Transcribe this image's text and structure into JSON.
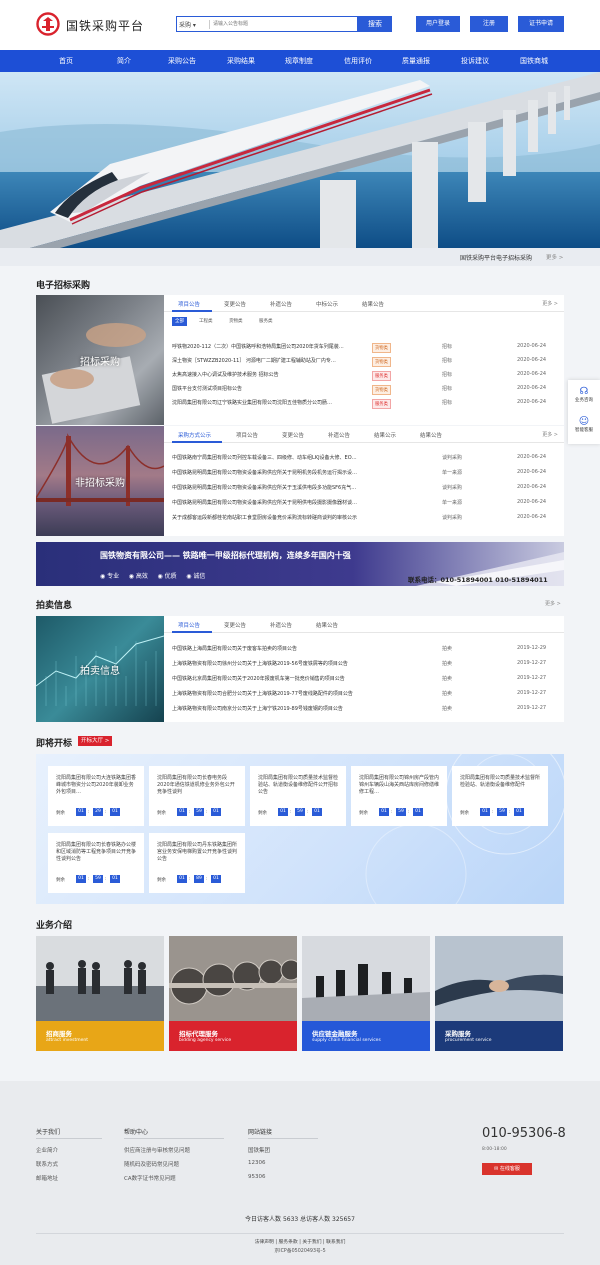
{
  "header": {
    "site_title": "国铁采购平台",
    "search_category": "采购",
    "search_placeholder": "请输入公告标题",
    "search_button": "搜索",
    "buttons": [
      "用户登录",
      "注册",
      "证书申请"
    ]
  },
  "nav": [
    "首页",
    "简介",
    "采购公告",
    "采购结果",
    "规章制度",
    "信用评价",
    "质量通报",
    "投诉建议",
    "国铁商城"
  ],
  "notice": {
    "text": "国铁采购平台电子招标采购",
    "more": "更多 >"
  },
  "tender": {
    "section_title": "电子招标采购",
    "photo_label": "招标采购",
    "tabs": [
      "项目公告",
      "变更公告",
      "补遗公告",
      "中标公示",
      "结果公告"
    ],
    "more": "更多 >",
    "chips": [
      "全部",
      "工程类",
      "货物类",
      "服务类"
    ],
    "rows": [
      {
        "title": "呼铁物2020-112（二次）中国铁路呼和浩特局集团公司2020年货车列尾装…",
        "tag": "货物类",
        "kind": "招标",
        "date": "2020-06-24"
      },
      {
        "title": "深土物资［STWZZB2020-11］ 河源电厂二期扩建工程辅助站及厂内专…",
        "tag": "货物类",
        "kind": "招标",
        "date": "2020-06-24"
      },
      {
        "title": "太焦高速接入中心调试及维护技术服务 招标公告",
        "tag": "服务类",
        "kind": "招标",
        "date": "2020-06-24"
      },
      {
        "title": "国铁平台支付测试项目招标公告",
        "tag": "货物类",
        "kind": "招标",
        "date": "2020-06-24"
      },
      {
        "title": "沈阳局集团有限公司辽宁铁路实业集团有限公司沈阳五佳物质分公司肠…",
        "tag": "服务类",
        "kind": "招标",
        "date": "2020-06-24"
      }
    ]
  },
  "nontender": {
    "photo_label": "非招标采购",
    "tabs": [
      "采购方式公示",
      "项目公告",
      "变更公告",
      "补遗公告",
      "结果公示",
      "结果公告"
    ],
    "more": "更多 >",
    "rows": [
      {
        "title": "中国铁路南宁局集团有限公司列控车载设备三、四级修、动车组LKJ设备大修、EO…",
        "kind": "谈判采购",
        "date": "2020-06-24"
      },
      {
        "title": "中国铁路昆明局集团有限公司物资设备采购供应所关于昆明机务段机务运行揭示设…",
        "kind": "单一来源",
        "date": "2020-06-24"
      },
      {
        "title": "中国铁路昆明局集团有限公司物资设备采购供应所关于玉溪供电段多功能SF6充气…",
        "kind": "谈判采购",
        "date": "2020-06-24"
      },
      {
        "title": "中国铁路昆明局集团有限公司物资设备采购供应所关于昆明供电段摄影摄像器材谈…",
        "kind": "单一来源",
        "date": "2020-06-24"
      },
      {
        "title": "关于成都客运段新都桂花南站职工食堂厨房设备竞价采购流标转磋商谈判的审核公示",
        "kind": "谈判采购",
        "date": "2020-06-24"
      }
    ]
  },
  "ad": {
    "headline": "国铁物资有限公司—— 铁路唯一甲级招标代理机构，连续多年国内十强",
    "features": [
      "专业",
      "高效",
      "优质",
      "诚信"
    ],
    "contact": "联系电话：010-51894001   010-51894011"
  },
  "auction": {
    "section_title": "拍卖信息",
    "more": "更多 >",
    "photo_label": "拍卖信息",
    "tabs": [
      "项目公告",
      "变更公告",
      "补遗公告",
      "结果公告"
    ],
    "rows": [
      {
        "title": "中国铁路上海局集团有限公司关于废客车拍卖的项目公告",
        "kind": "拍卖",
        "date": "2019-12-29"
      },
      {
        "title": "上海铁路物资有限公司徐州分公司关于上海铁路2019-56号废铁屑等的项目公告",
        "kind": "拍卖",
        "date": "2019-12-27"
      },
      {
        "title": "中国铁路北京局集团有限公司关于2020年报废机车第一批竞价销售的项目公告",
        "kind": "拍卖",
        "date": "2019-12-27"
      },
      {
        "title": "上海铁路物资有限公司合肥分公司关于上海铁路2019-77号废线路配件的项目公告",
        "kind": "拍卖",
        "date": "2019-12-27"
      },
      {
        "title": "上海铁路物资有限公司南京分公司关于上海宁铁2019-89号钱废钢的项目公告",
        "kind": "拍卖",
        "date": "2019-12-27"
      }
    ]
  },
  "opening": {
    "section_title": "即将开标",
    "hall_button": "开标大厅 >",
    "countdown_label": "剩余",
    "cards": [
      {
        "text": "沈阳局集团有限公司大连铁路集团香峰城市物资分公司2020年装卸业务外包项目…",
        "d": "01",
        "h": "29",
        "m": "01"
      },
      {
        "text": "沈阳局集团有限公司长春电务段2020年通信铁道机修业务外包公开竞争性谈判",
        "d": "01",
        "h": "59",
        "m": "01"
      },
      {
        "text": "沈阳局集团有限公司质量技术监督检验站、轨道衡设备维修配件公开招标公告",
        "d": "01",
        "h": "59",
        "m": "01"
      },
      {
        "text": "沈阳局集团有限公司锦州房产段管内锦州车辆段山海关西站库房间修缮维修工程…",
        "d": "01",
        "h": "59",
        "m": "01"
      },
      {
        "text": "沈阳局集团有限公司质量技术监督所检验站、轨道衡设备维修配件",
        "d": "01",
        "h": "59",
        "m": "01"
      },
      {
        "text": "沈阳局集团有限公司长春铁路办公楼和区域消防等工程竞争项目公开竞争性谈判公告",
        "d": "01",
        "h": "59",
        "m": "01"
      },
      {
        "text": "沈阳局集团有限公司丹东铁路集团所宫业务安保电梯购置公开竞争性谈判公告",
        "d": "01",
        "h": "89",
        "m": "01"
      }
    ]
  },
  "business": {
    "section_title": "业务介绍",
    "items": [
      {
        "zh": "招商服务",
        "en": "attract investment",
        "color": "#e8a617"
      },
      {
        "zh": "招标代理服务",
        "en": "bidding agency service",
        "color": "#d9232d"
      },
      {
        "zh": "供应链金融服务",
        "en": "supply chain financial services",
        "color": "#2558d8"
      },
      {
        "zh": "采购服务",
        "en": "procurement service",
        "color": "#1c3a7a"
      }
    ]
  },
  "footer": {
    "col1_title": "关于我们",
    "col1_links": [
      "企业简介",
      "联系方式",
      "邮箱地址"
    ],
    "col2_title": "帮助中心",
    "col2_links": [
      "供应商注册与审核常见问题",
      "随机码及密码常见问题",
      "CA数字证书常见问题"
    ],
    "col3_title": "网站链接",
    "col3_links": [
      "国铁集团",
      "12306",
      "95306"
    ],
    "phone": "010-95306-8",
    "phone_time": "8:00-18:00",
    "service_button": "在线客服",
    "visitors": "今日访客人数 5633   总访客人数 325657",
    "bottom_links": "法律声明 | 服务条款 | 关于我们 | 联系我们",
    "icp": "京ICP备05020493号-5"
  },
  "float": {
    "consult": "业务咨询",
    "service": "智能客服"
  }
}
